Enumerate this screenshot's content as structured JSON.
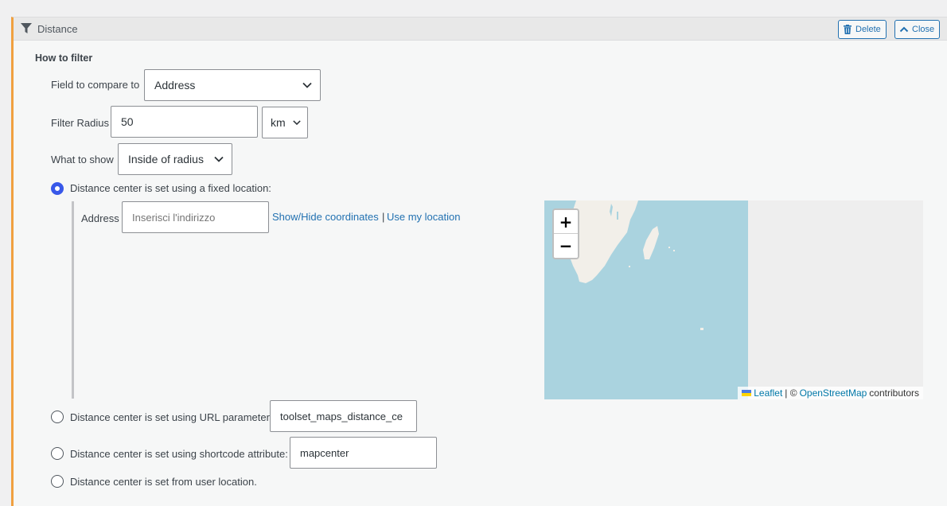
{
  "header": {
    "title": "Distance",
    "delete_label": "Delete",
    "close_label": "Close"
  },
  "section": {
    "title": "How to filter"
  },
  "field_compare": {
    "label": "Field to compare to",
    "value": "Address"
  },
  "radius": {
    "label": "Filter Radius",
    "value": "50",
    "unit": "km"
  },
  "what_show": {
    "label": "What to show",
    "value": "Inside of radius"
  },
  "options": {
    "fixed": "Distance center is set using a fixed location:",
    "url": "Distance center is set using URL parameter:",
    "shortcode": "Distance center is set using shortcode attribute:",
    "user": "Distance center is set from user location."
  },
  "selected_option": "fixed",
  "address": {
    "label": "Address",
    "placeholder": "Inserisci l'indirizzo",
    "show_hide": "Show/Hide coordinates",
    "separator": "|",
    "use_location": "Use my location"
  },
  "url_param": {
    "value": "toolset_maps_distance_ce"
  },
  "shortcode_attr": {
    "value": "mapcenter"
  },
  "map": {
    "zoom_in": "+",
    "zoom_out": "−",
    "attribution_leaflet": "Leaflet",
    "attribution_sep": "| ©",
    "attribution_osm": "OpenStreetMap",
    "attribution_tail": "contributors",
    "colors": {
      "water": "#aad3df",
      "land": "#f2efe9",
      "empty": "#eeeeee"
    }
  },
  "colors": {
    "accent": "#2271b1",
    "radio": "#3858e9",
    "panel_border": "#f0a040"
  }
}
